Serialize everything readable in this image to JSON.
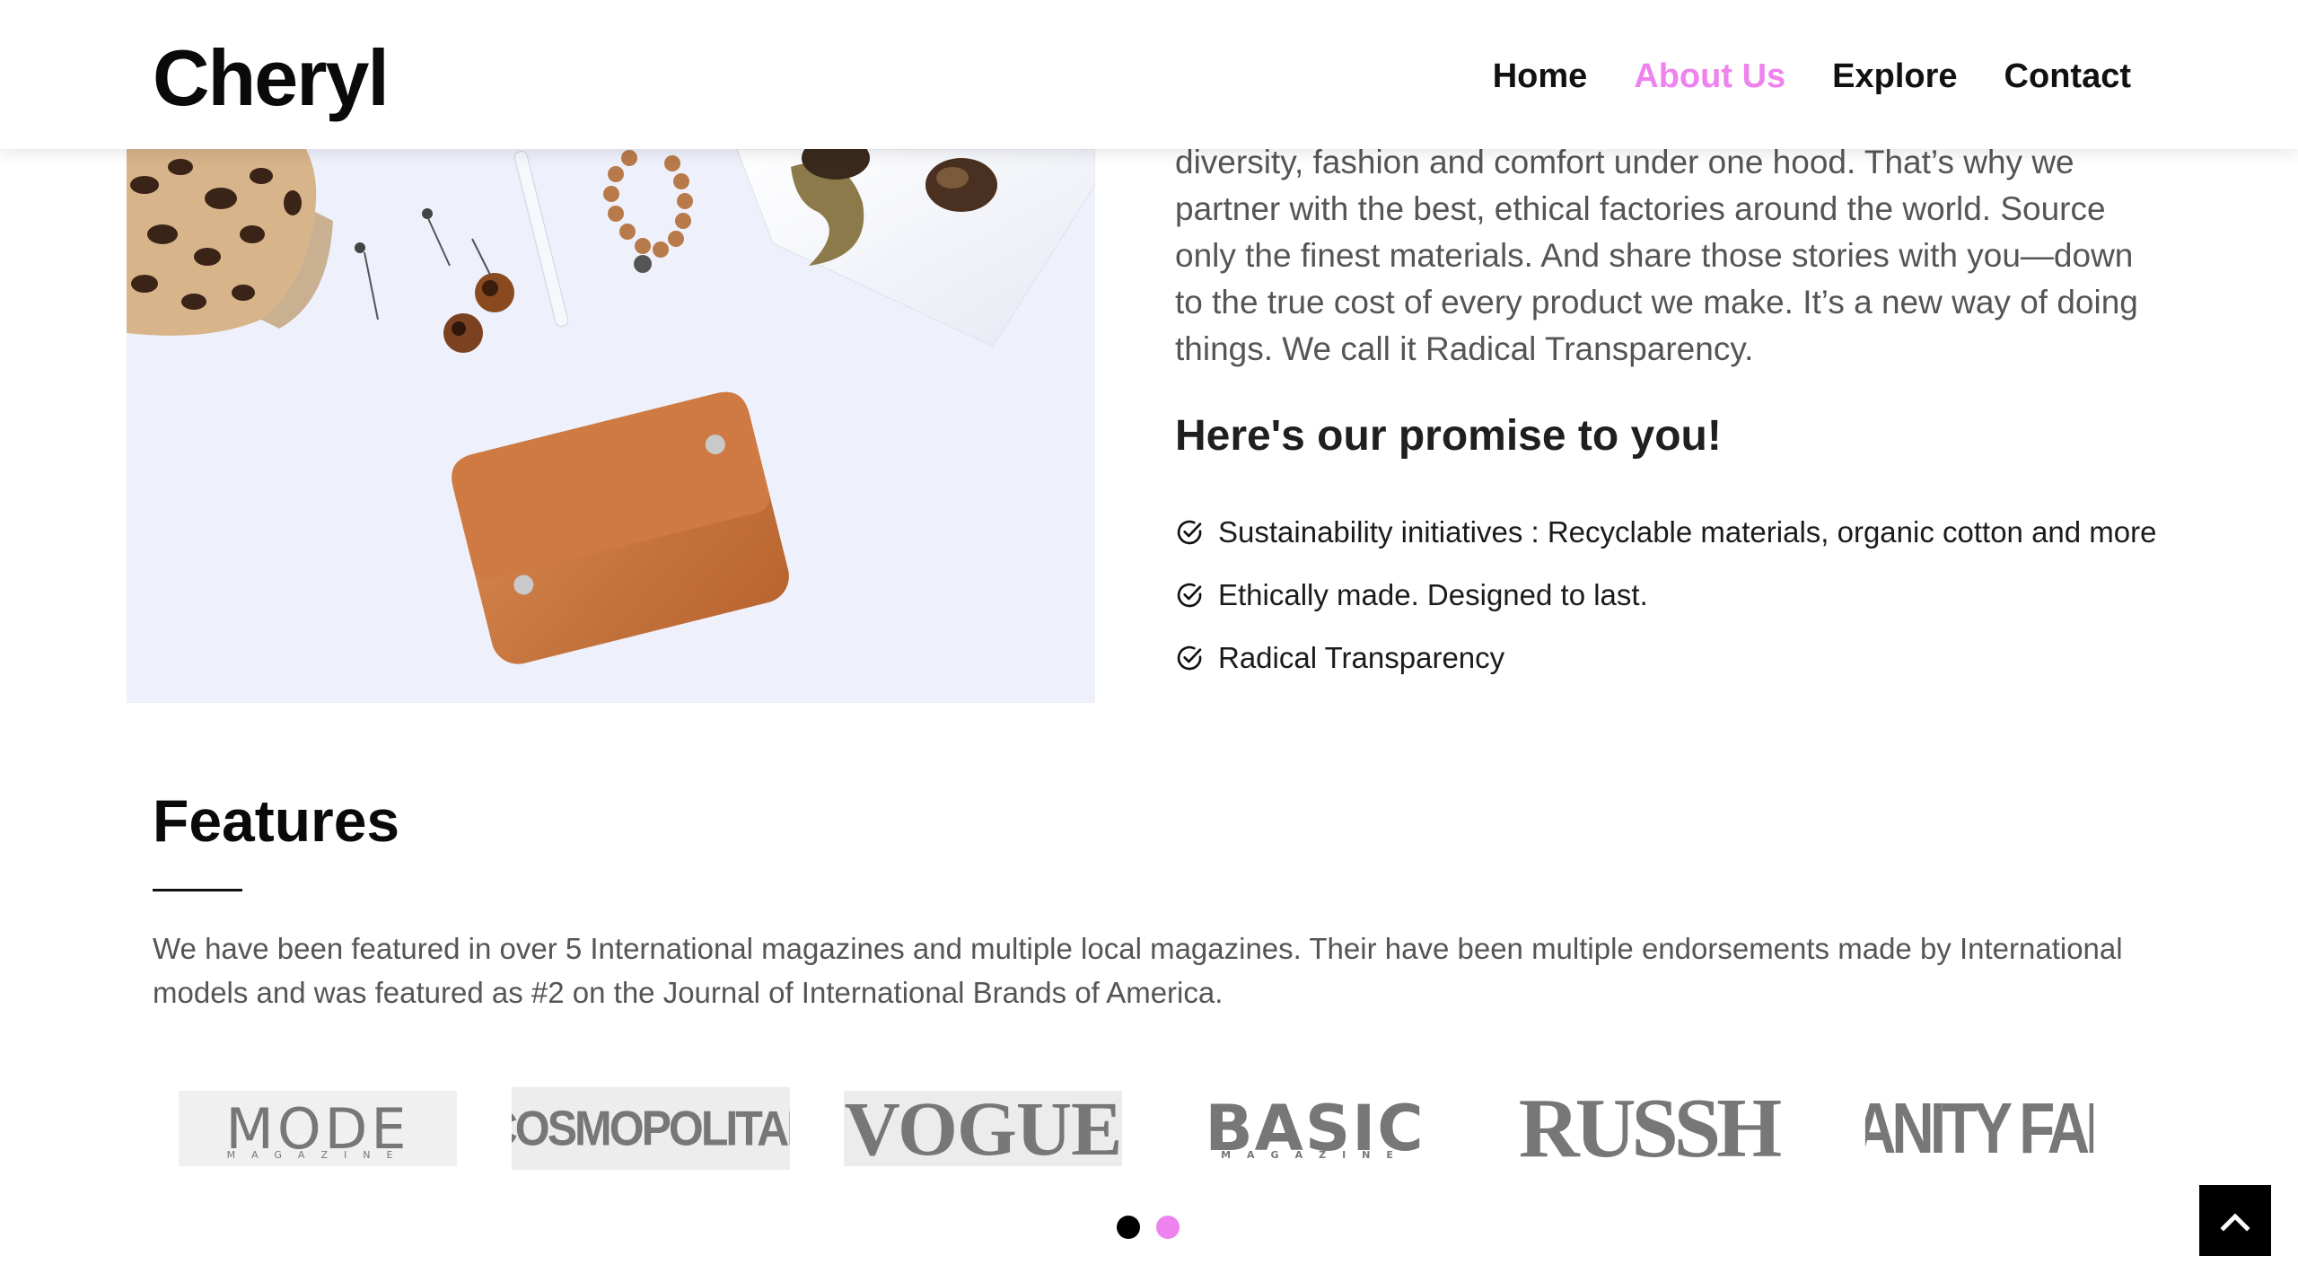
{
  "brand": {
    "name": "Cheryl"
  },
  "nav": {
    "items": [
      {
        "label": "Home",
        "active": false
      },
      {
        "label": "About Us",
        "active": true
      },
      {
        "label": "Explore",
        "active": false
      },
      {
        "label": "Contact",
        "active": false
      }
    ]
  },
  "about": {
    "intro": "diversity, fashion and comfort under one hood. That’s why we partner with the best, ethical factories around the world. Source only the finest materials. And share those stories with you—down to the true cost of every product we make. It’s a new way of doing things. We call it Radical Transparency.",
    "promise_title": "Here's our promise to you!",
    "promises": [
      "Sustainability initiatives : Recyclable materials, organic cotton and more",
      "Ethically made. Designed to last.",
      "Radical Transparency"
    ]
  },
  "features": {
    "title": "Features",
    "text": "We have been featured in over 5 International magazines and multiple local magazines. Their have been multiple endorsements made by International models and was featured as #2 on the Journal of International Brands of America.",
    "magazines": [
      {
        "name": "MODE",
        "sub": "MAGAZINE"
      },
      {
        "name": "COSMOPOLITAN"
      },
      {
        "name": "VOGUE"
      },
      {
        "name": "BASIC",
        "sub": "MAGAZINE"
      },
      {
        "name": "RUSSH"
      },
      {
        "name": "VANITY FAIR"
      }
    ]
  },
  "carousel": {
    "dots": 2,
    "active_index": 0
  },
  "colors": {
    "accent": "#ee82ee",
    "text_dark": "#111111",
    "text_muted": "#555555",
    "dot_active": "#000000",
    "dot_inactive": "#ee82ee"
  },
  "icons": {
    "check": "check-circle-icon",
    "scroll_top": "chevron-up-icon"
  }
}
